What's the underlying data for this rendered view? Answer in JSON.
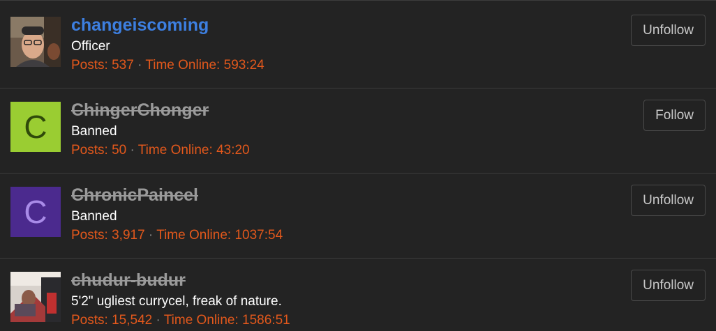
{
  "users": [
    {
      "username": "changeiscoming",
      "status": "active",
      "title": "Officer",
      "posts_label": "Posts:",
      "posts": "537",
      "separator": "·",
      "time_label": "Time Online:",
      "time_online": "593:24",
      "action_label": "Unfollow",
      "avatar": {
        "type": "photo",
        "description_icon": "user-photo-avatar"
      }
    },
    {
      "username": "ChingerChonger",
      "status": "banned",
      "title": "Banned",
      "posts_label": "Posts:",
      "posts": "50",
      "separator": "·",
      "time_label": "Time Online:",
      "time_online": "43:20",
      "action_label": "Follow",
      "avatar": {
        "type": "letter",
        "letter": "C",
        "bg": "#9acd32",
        "fg": "#2f4a0a"
      }
    },
    {
      "username": "ChronicPaincel",
      "status": "banned",
      "title": "Banned",
      "posts_label": "Posts:",
      "posts": "3,917",
      "separator": "·",
      "time_label": "Time Online:",
      "time_online": "1037:54",
      "action_label": "Unfollow",
      "avatar": {
        "type": "letter",
        "letter": "C",
        "bg": "#4b2a8e",
        "fg": "#a98be8"
      }
    },
    {
      "username": "chudur-budur",
      "status": "banned",
      "title": "5'2\" ugliest currycel, freak of nature.",
      "posts_label": "Posts:",
      "posts": "15,542",
      "separator": "·",
      "time_label": "Time Online:",
      "time_online": "1586:51",
      "action_label": "Unfollow",
      "avatar": {
        "type": "photo",
        "description_icon": "user-photo-avatar"
      }
    }
  ],
  "colors": {
    "background": "#232323",
    "username_active": "#3d7fe0",
    "username_banned": "#9a9a9a",
    "stats": "#e2581c",
    "divider": "#3c3c3c"
  }
}
